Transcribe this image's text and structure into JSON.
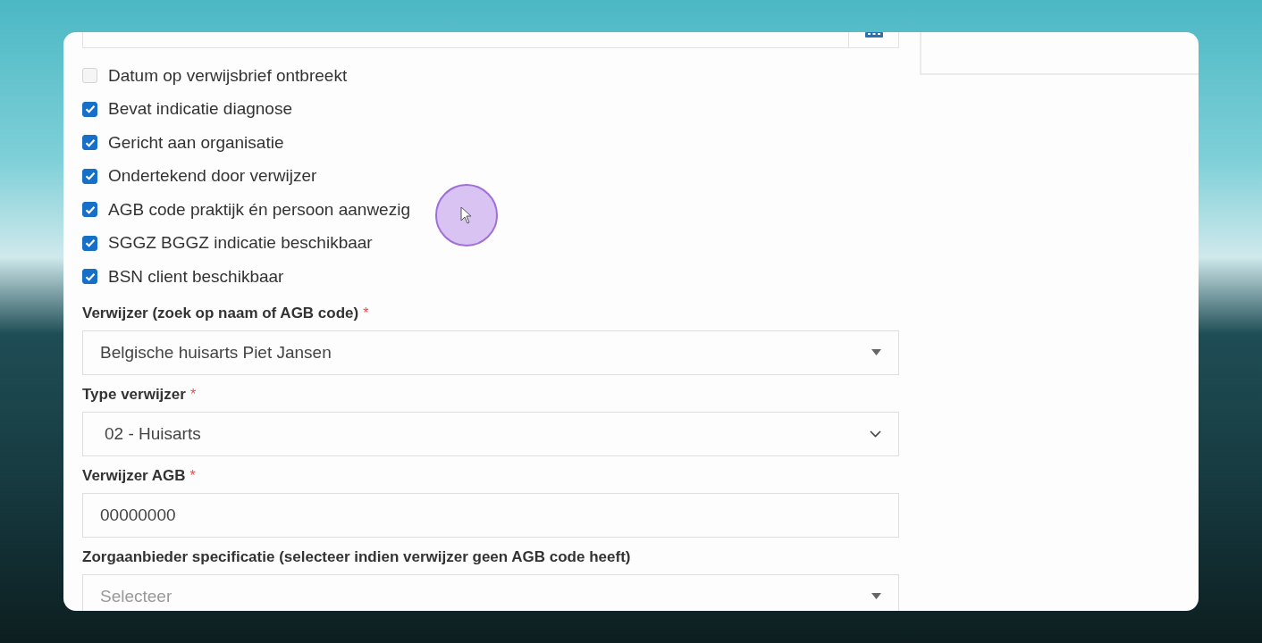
{
  "checkboxes": [
    {
      "label": "Datum op verwijsbrief ontbreekt",
      "checked": false
    },
    {
      "label": "Bevat indicatie diagnose",
      "checked": true
    },
    {
      "label": "Gericht aan organisatie",
      "checked": true
    },
    {
      "label": "Ondertekend door verwijzer",
      "checked": true
    },
    {
      "label": "AGB code praktijk én persoon aanwezig",
      "checked": true
    },
    {
      "label": "SGGZ BGGZ indicatie beschikbaar",
      "checked": true
    },
    {
      "label": "BSN client beschikbaar",
      "checked": true
    }
  ],
  "fields": [
    {
      "kind": "search-select",
      "label": "Verwijzer (zoek op naam of AGB code)",
      "required_mark": "*",
      "value": "Belgische huisarts Piet Jansen"
    },
    {
      "kind": "select",
      "label": "Type verwijzer",
      "required_mark": "*",
      "value": "02 - Huisarts"
    },
    {
      "kind": "input",
      "label": "Verwijzer AGB",
      "required_mark": "*",
      "value": "00000000"
    },
    {
      "kind": "search-select",
      "label": "Zorgaanbieder specificatie (selecteer indien verwijzer geen AGB code heeft)",
      "placeholder": "Selecteer"
    }
  ]
}
